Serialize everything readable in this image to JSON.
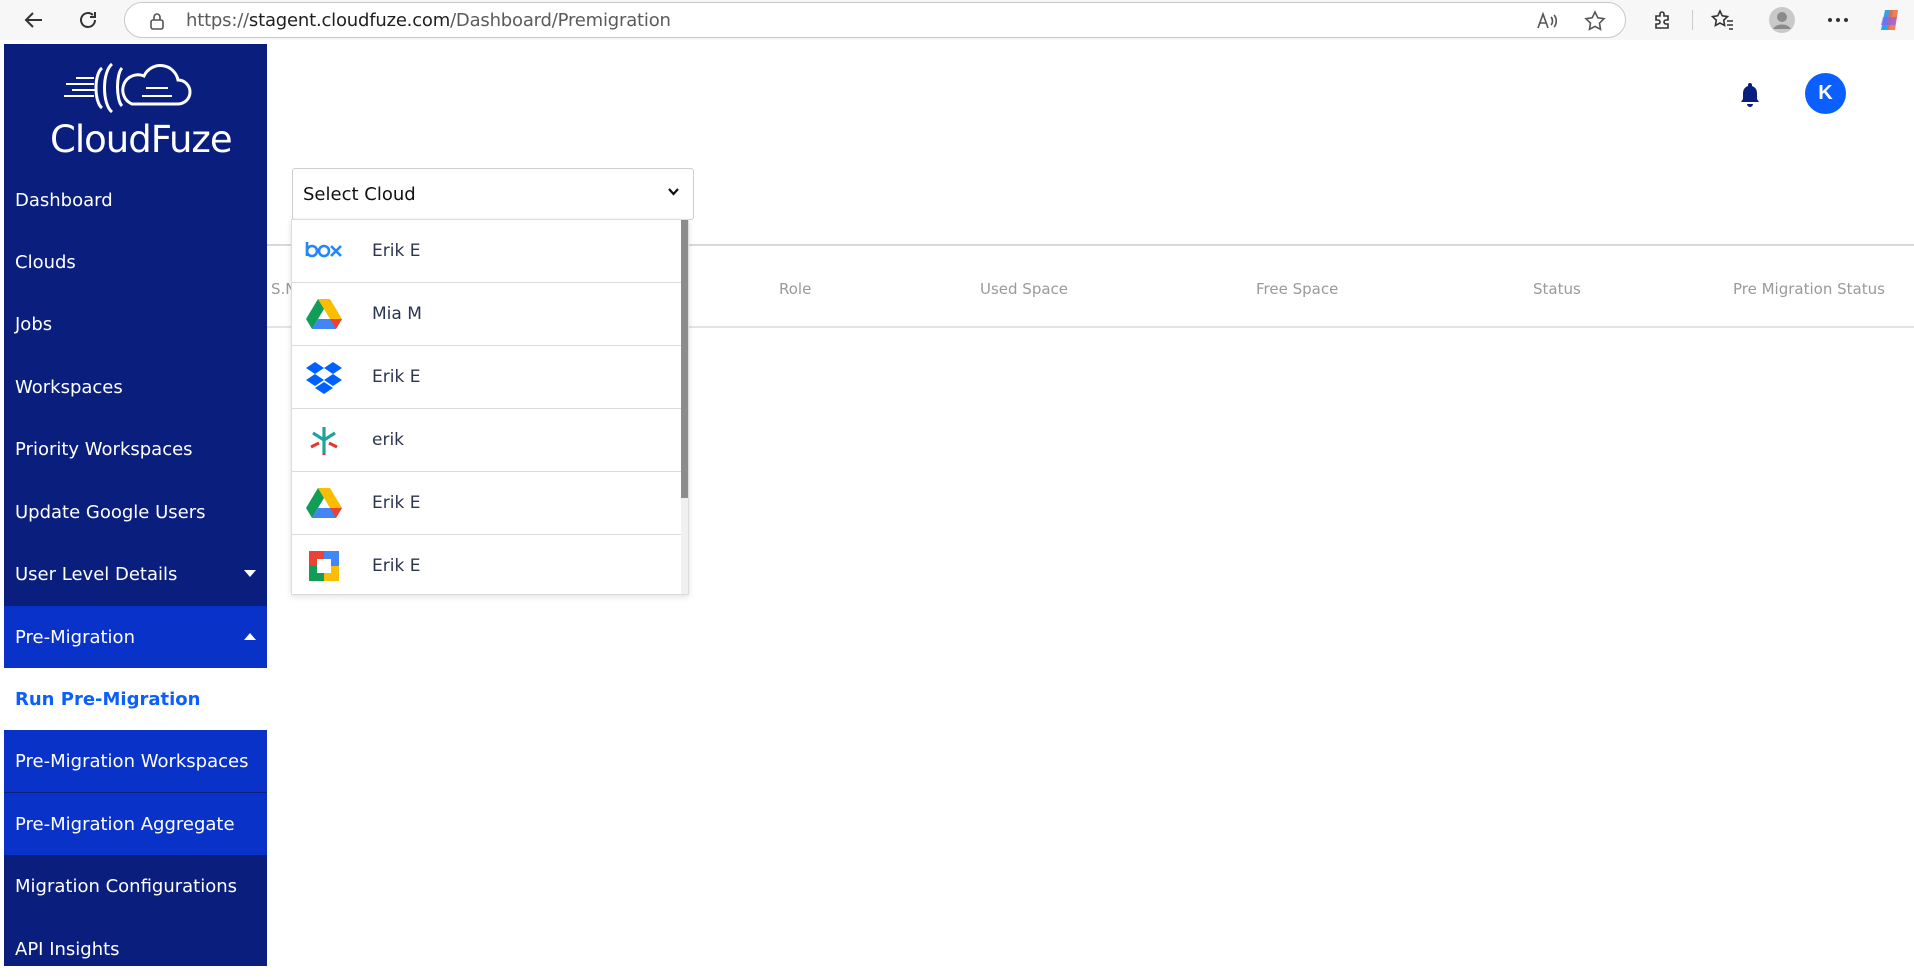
{
  "browser": {
    "url_prefix": "https://",
    "url_host": "stagent.cloudfuze.com",
    "url_path": "/Dashboard/Premigration"
  },
  "brand": {
    "name": "CloudFuze"
  },
  "sidebar": {
    "items": [
      {
        "label": "Dashboard"
      },
      {
        "label": "Clouds"
      },
      {
        "label": "Jobs"
      },
      {
        "label": "Workspaces"
      },
      {
        "label": "Priority Workspaces"
      },
      {
        "label": "Update Google Users"
      },
      {
        "label": "User Level Details"
      },
      {
        "label": "Pre-Migration"
      },
      {
        "label": "Run Pre-Migration"
      },
      {
        "label": "Pre-Migration Workspaces"
      },
      {
        "label": "Pre-Migration Aggregate"
      },
      {
        "label": "Migration Configurations"
      },
      {
        "label": "API Insights"
      }
    ]
  },
  "header": {
    "avatar_initial": "K"
  },
  "select": {
    "value": "Select Cloud"
  },
  "table": {
    "headers": [
      "S.No",
      "Role",
      "Used Space",
      "Free Space",
      "Status",
      "Pre Migration Status"
    ]
  },
  "dropdown": {
    "options": [
      {
        "icon": "box-icon",
        "label": "Erik E"
      },
      {
        "icon": "google-drive-icon",
        "label": "Mia M"
      },
      {
        "icon": "dropbox-icon",
        "label": "Erik E"
      },
      {
        "icon": "egnyte-icon",
        "label": "erik"
      },
      {
        "icon": "google-drive-icon",
        "label": "Erik E"
      },
      {
        "icon": "google-chat-icon",
        "label": "Erik E"
      }
    ]
  },
  "colors": {
    "sidebar_bg": "#0a1f7d",
    "sidebar_section_bg": "#0932c8",
    "accent": "#0b5fff"
  }
}
